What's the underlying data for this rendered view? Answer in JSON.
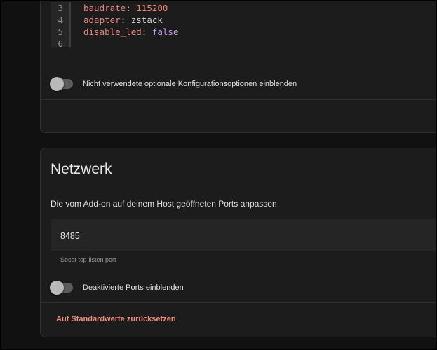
{
  "config_editor": {
    "line_numbers": [
      "3",
      "4",
      "5",
      "6"
    ],
    "lines": [
      {
        "key": "baudrate",
        "sep": ": ",
        "value": "115200",
        "type": "number"
      },
      {
        "key": "adapter",
        "sep": ": ",
        "value": "zstack",
        "type": "string"
      },
      {
        "key": "disable_led",
        "sep": ": ",
        "value": "false",
        "type": "bool"
      },
      {
        "key": "",
        "sep": "",
        "value": "",
        "type": "empty"
      }
    ]
  },
  "options_toggle": {
    "label": "Nicht verwendete optionale Konfigurationsoptionen einblenden",
    "state": "off"
  },
  "network": {
    "title": "Netzwerk",
    "description": "Die vom Add-on auf deinem Host geöffneten Ports anpassen",
    "port_value": "8485",
    "port_helper": "Socat tcp-listen port",
    "disabled_ports_toggle": {
      "label": "Deaktivierte Ports einblenden",
      "state": "off"
    },
    "reset_label": "Auf Standardwerte zurücksetzen"
  },
  "colors": {
    "key": "#e68b7f",
    "number": "#f3836f",
    "bool": "#c39bf0",
    "accent": "#f08b7e"
  }
}
